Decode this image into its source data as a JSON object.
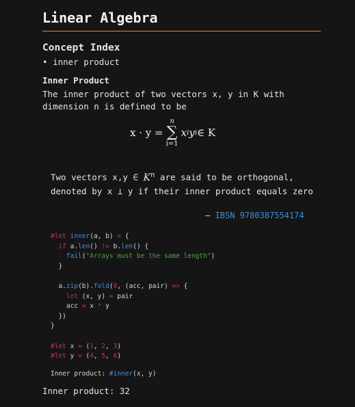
{
  "doc": {
    "title": "Linear Algebra",
    "concept_index": {
      "heading": "Concept Index",
      "items": [
        "inner product"
      ]
    },
    "section": {
      "heading": "Inner Product",
      "text": "The inner product of two vectors x, y in K with dimension n is defined to be"
    },
    "equation": {
      "lhs": "x · y =",
      "sum_upper": "n",
      "sum_lower": "i=1",
      "rhs": "x",
      "rhs_sub_i": "i",
      "rhs_y": "y",
      "rhs_tail": " ∈ K"
    },
    "quote": {
      "before": "Two vectors x,y ∈ ",
      "space": "K",
      "exp": "n",
      "after": " are said to be orthogonal, denoted by x ⊥ y if their inner product equals zero",
      "dash": "— ",
      "source": "IBSN 9780387554174"
    },
    "code": {
      "l1_kw": "#let",
      "l1_fn": "inner",
      "l1_rest": "(a, b) ",
      "l1_eq": "=",
      "l1_end": " {",
      "l2_kw": "if",
      "l2_a": " a.",
      "l2_fn1": "len",
      "l2_mid": "() ",
      "l2_op": "!=",
      "l2_b": " b.",
      "l2_fn2": "len",
      "l2_end": "() {",
      "l3_fn": "fail",
      "l3_open": "(",
      "l3_str": "\"Arrays must be the same length\"",
      "l3_close": ")",
      "l4": "}",
      "l6_a": "a.",
      "l6_fn1": "zip",
      "l6_b": "(b).",
      "l6_fn2": "fold",
      "l6_open": "(",
      "l6_num": "0",
      "l6_rest": ", (acc, pair) ",
      "l6_arrow": "=>",
      "l6_end": " {",
      "l7_kw": "let",
      "l7_rest": " (x, y) ",
      "l7_eq": "=",
      "l7_end": " pair",
      "l8_a": "acc ",
      "l8_eq": "=",
      "l8_b": " x ",
      "l8_op": "*",
      "l8_c": " y",
      "l9": "})",
      "l10": "}",
      "l12_kw": "#let",
      "l12_a": " x ",
      "l12_eq": "=",
      "l12_open": " (",
      "l12_n1": "1",
      "l12_n2": "2",
      "l12_n3": "3",
      "l13_kw": "#let",
      "l13_a": " y ",
      "l13_eq": "=",
      "l13_open": " (",
      "l13_n1": "4",
      "l13_n2": "5",
      "l13_n3": "6",
      "comma": ", ",
      "close": ")"
    },
    "tail": {
      "prefix": "Inner product: ",
      "call_fn": "#inner",
      "call_args": "(x, y)"
    },
    "result": "Inner product: 32"
  },
  "colors": {
    "background": "#151515",
    "rule": "#e08a2c",
    "link": "#3b8fd6",
    "keyword": "#c4345a",
    "function": "#4a8fd8",
    "string": "#4ea24e"
  }
}
